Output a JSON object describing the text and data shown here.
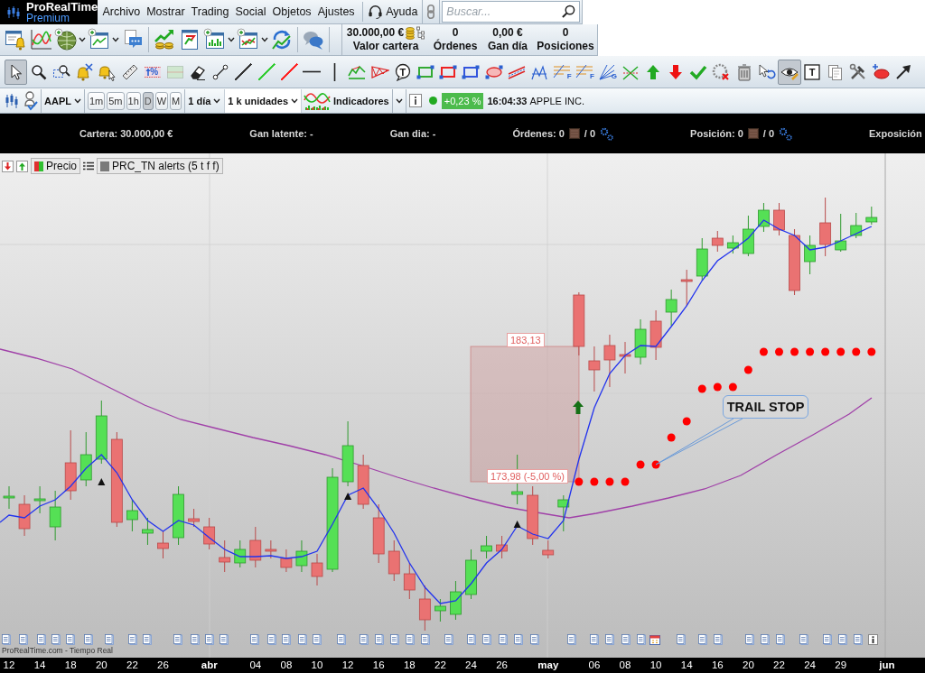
{
  "brand": {
    "name": "ProRealTime",
    "edition": "Premium"
  },
  "menu": [
    {
      "label": "Archivo"
    },
    {
      "label": "Mostrar"
    },
    {
      "label": "Trading"
    },
    {
      "label": "Social"
    },
    {
      "label": "Objetos"
    },
    {
      "label": "Ajustes"
    }
  ],
  "help": {
    "label": "Ayuda"
  },
  "search": {
    "placeholder": "Buscar..."
  },
  "main_toolbar": [
    [
      {
        "kind": "alerts",
        "dropdown": false
      },
      {
        "kind": "indicators",
        "dropdown": false
      },
      {
        "kind": "globe",
        "dropdown": true
      },
      {
        "kind": "new-chart",
        "dropdown": true
      },
      {
        "kind": "chat",
        "dropdown": false
      }
    ],
    [
      {
        "kind": "rising",
        "dropdown": false
      },
      {
        "kind": "refresh-doc",
        "dropdown": false
      },
      {
        "kind": "chart-add",
        "dropdown": true
      },
      {
        "kind": "chart-add-alt",
        "dropdown": true
      },
      {
        "kind": "cycle",
        "dropdown": false
      }
    ],
    [
      {
        "kind": "bubbles",
        "dropdown": false
      }
    ]
  ],
  "portfolio": [
    {
      "kind": "balance",
      "value": "30.000,00 €",
      "label": "Valor cartera"
    },
    {
      "kind": "count",
      "value": "0",
      "label": "Órdenes"
    },
    {
      "kind": "count",
      "value": "0,00 €",
      "label": "Gan día"
    },
    {
      "kind": "count",
      "value": "0",
      "label": "Posiciones"
    }
  ],
  "drawing_tools": [
    {
      "kind": "cursor",
      "selected": true
    },
    {
      "kind": "zoom",
      "selected": false
    },
    {
      "kind": "zoom-area",
      "selected": false
    },
    {
      "kind": "alert-remove",
      "selected": false
    },
    {
      "kind": "alert-add",
      "selected": false
    },
    {
      "kind": "ruler",
      "selected": false
    },
    {
      "kind": "percent",
      "glyph": "%",
      "selected": false
    },
    {
      "kind": "area",
      "selected": false
    },
    {
      "kind": "eraser",
      "selected": false
    },
    {
      "kind": "segment",
      "selected": false
    },
    {
      "kind": "line",
      "color": "#333333",
      "selected": false
    },
    {
      "kind": "line",
      "color": "#33cc33",
      "selected": false
    },
    {
      "kind": "line",
      "color": "#ff2222",
      "selected": false
    },
    {
      "kind": "hline",
      "selected": false
    },
    {
      "kind": "vline",
      "selected": false
    },
    {
      "kind": "zigzag",
      "selected": false
    },
    {
      "kind": "triangle",
      "selected": false
    },
    {
      "kind": "bubble",
      "glyph": "T",
      "selected": false
    },
    {
      "kind": "rect",
      "color": "#33aa33",
      "selected": false
    },
    {
      "kind": "rect",
      "color": "#ee2222",
      "selected": false
    },
    {
      "kind": "rect",
      "color": "#3355dd",
      "selected": false
    },
    {
      "kind": "ellipse",
      "selected": false
    },
    {
      "kind": "channel",
      "selected": false
    },
    {
      "kind": "pattern",
      "selected": false
    },
    {
      "kind": "levels",
      "glyph": "F",
      "selected": false
    },
    {
      "kind": "levels",
      "glyph": "F",
      "selected": false
    },
    {
      "kind": "fan",
      "glyph": "G",
      "selected": false
    },
    {
      "kind": "cross",
      "selected": false
    },
    {
      "kind": "buy",
      "selected": false
    },
    {
      "kind": "sell",
      "selected": false
    },
    {
      "kind": "check",
      "selected": false
    },
    {
      "kind": "wheel",
      "selected": false
    },
    {
      "kind": "trash",
      "selected": false
    },
    {
      "kind": "undo",
      "selected": false
    },
    {
      "kind": "eye",
      "selected": true
    },
    {
      "kind": "textbox",
      "glyph": "T",
      "selected": false
    },
    {
      "kind": "copy",
      "selected": false
    },
    {
      "kind": "tools",
      "selected": false
    },
    {
      "kind": "ellipse-add",
      "selected": false
    },
    {
      "kind": "arrow",
      "selected": false
    }
  ],
  "instrument_bar": {
    "symbol": "AAPL",
    "timeframes": [
      {
        "label": "1m",
        "selected": false
      },
      {
        "label": "5m",
        "selected": false
      },
      {
        "label": "1h",
        "selected": false
      },
      {
        "label": "D",
        "selected": true
      },
      {
        "label": "W",
        "selected": false
      },
      {
        "label": "M",
        "selected": false
      }
    ],
    "period": "1 día",
    "units": "1 k unidades",
    "indicators": "Indicadores",
    "market_open": true,
    "change": "+0,23 %",
    "time": "16:04:33",
    "name": "APPLE INC."
  },
  "account_bar": [
    {
      "kind": "text",
      "text": "Cartera: 30.000,00 €"
    },
    {
      "kind": "text",
      "text": "Gan latente: -"
    },
    {
      "kind": "text",
      "text": "Gan dia: -"
    },
    {
      "kind": "counter",
      "text": "Órdenes: 0",
      "total": "/ 0"
    },
    {
      "kind": "counter",
      "text": "Posición: 0",
      "total": "/ 0"
    },
    {
      "kind": "text",
      "text": "Exposición"
    }
  ],
  "legend": [
    {
      "kind": "price",
      "label": "Precio"
    },
    {
      "kind": "indicator",
      "label": "PRC_TN alerts (5 t f f)"
    }
  ],
  "chart": {
    "zone": {
      "top_label": "183,13",
      "bottom_label": "173,98 (-5,00 %)"
    },
    "callout": "TRAIL STOP",
    "source": "ProRealTime.com - Tiempo Real"
  },
  "x_axis": [
    {
      "label": "12",
      "kind": "day"
    },
    {
      "label": "14",
      "kind": "day"
    },
    {
      "label": "18",
      "kind": "day"
    },
    {
      "label": "20",
      "kind": "day"
    },
    {
      "label": "22",
      "kind": "day"
    },
    {
      "label": "26",
      "kind": "day"
    },
    {
      "label": "abr",
      "kind": "month"
    },
    {
      "label": "04",
      "kind": "day"
    },
    {
      "label": "08",
      "kind": "day"
    },
    {
      "label": "10",
      "kind": "day"
    },
    {
      "label": "12",
      "kind": "day"
    },
    {
      "label": "16",
      "kind": "day"
    },
    {
      "label": "18",
      "kind": "day"
    },
    {
      "label": "22",
      "kind": "day"
    },
    {
      "label": "24",
      "kind": "day"
    },
    {
      "label": "26",
      "kind": "day"
    },
    {
      "label": "may",
      "kind": "month"
    },
    {
      "label": "06",
      "kind": "day"
    },
    {
      "label": "08",
      "kind": "day"
    },
    {
      "label": "10",
      "kind": "day"
    },
    {
      "label": "14",
      "kind": "day"
    },
    {
      "label": "16",
      "kind": "day"
    },
    {
      "label": "20",
      "kind": "day"
    },
    {
      "label": "22",
      "kind": "day"
    },
    {
      "label": "24",
      "kind": "day"
    },
    {
      "label": "29",
      "kind": "day"
    },
    {
      "label": "jun",
      "kind": "month"
    }
  ]
}
